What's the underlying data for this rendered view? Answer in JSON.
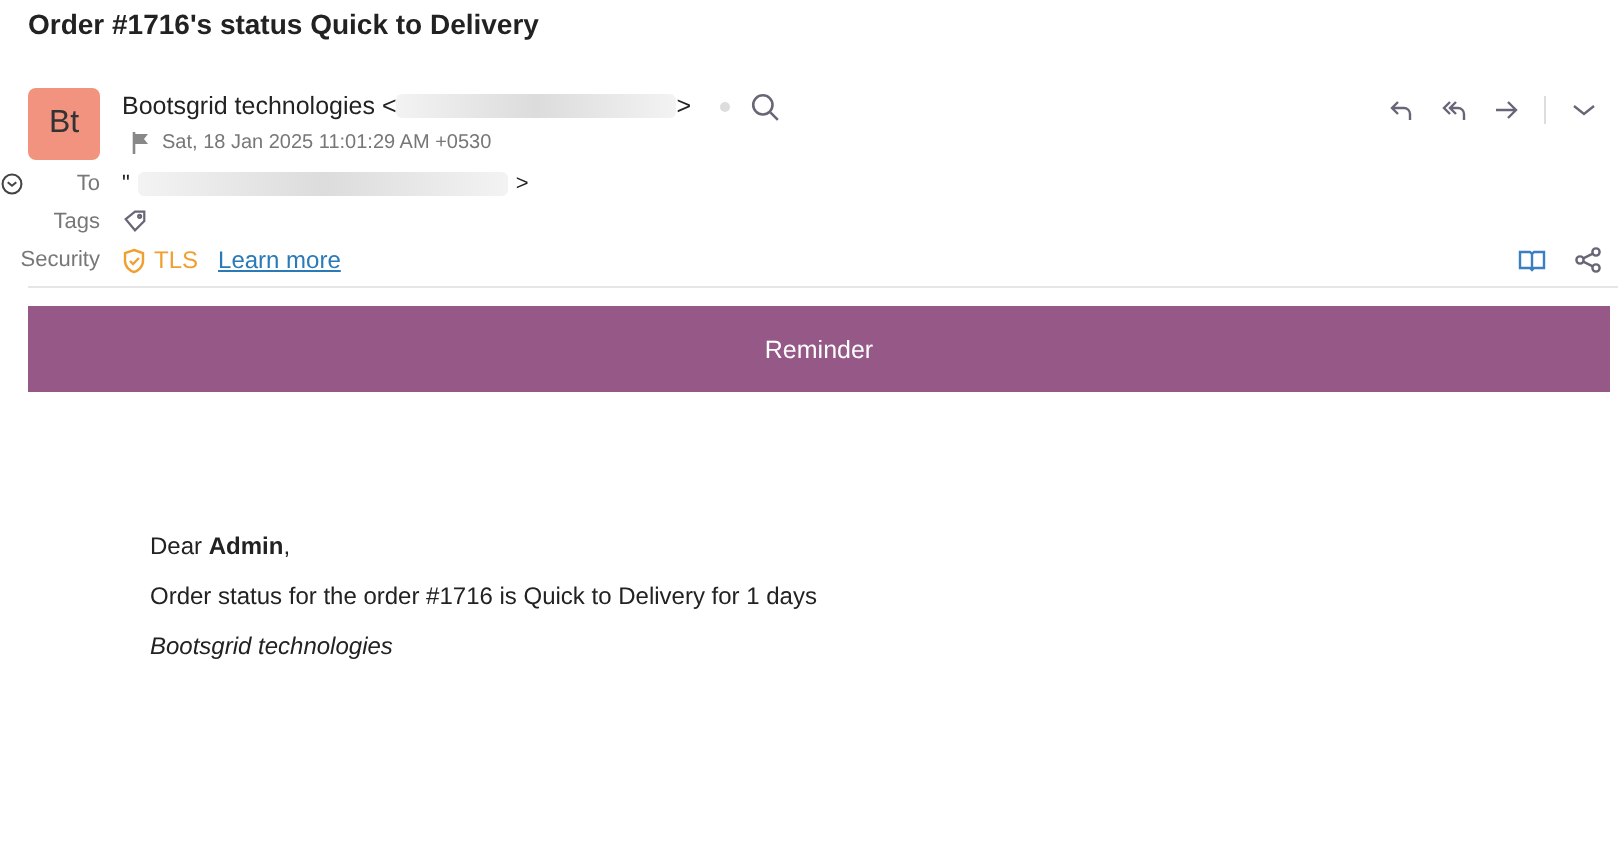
{
  "subject": "Order #1716's status Quick to Delivery",
  "sender": {
    "initials": "Bt",
    "name": "Bootsgrid technologies <",
    "name_end": ">",
    "date": "Sat, 18 Jan 2025 11:01:29 AM +0530"
  },
  "to": {
    "label": "To",
    "start": "\"",
    "end": ">"
  },
  "tags": {
    "label": "Tags"
  },
  "security": {
    "label": "Security",
    "value": "TLS",
    "link": "Learn more"
  },
  "banner": {
    "title": "Reminder"
  },
  "body": {
    "greeting": "Dear **Admin**,",
    "message": "Order status for the order #1716 is Quick to Delivery for 1 days",
    "signature": "Bootsgrid technologies"
  }
}
